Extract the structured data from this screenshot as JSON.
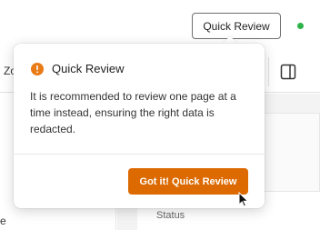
{
  "header": {
    "quick_review_label": "Quick Review",
    "status_color": "#2fb24a"
  },
  "toolbar": {
    "partial_label": "Zo",
    "panel_icon": "panel-toggle-icon"
  },
  "sidebar": {
    "partial_text": "e"
  },
  "content": {
    "status_label": "Status"
  },
  "popover": {
    "icon": "info-icon",
    "icon_color": "#e97b16",
    "title": "Quick Review",
    "body": "It is recommended to review one page at a time instead, ensuring the right data is redacted.",
    "button_label": "Got it! Quick Review",
    "button_color": "#dc6a00"
  },
  "cursor": "mouse-pointer-icon"
}
